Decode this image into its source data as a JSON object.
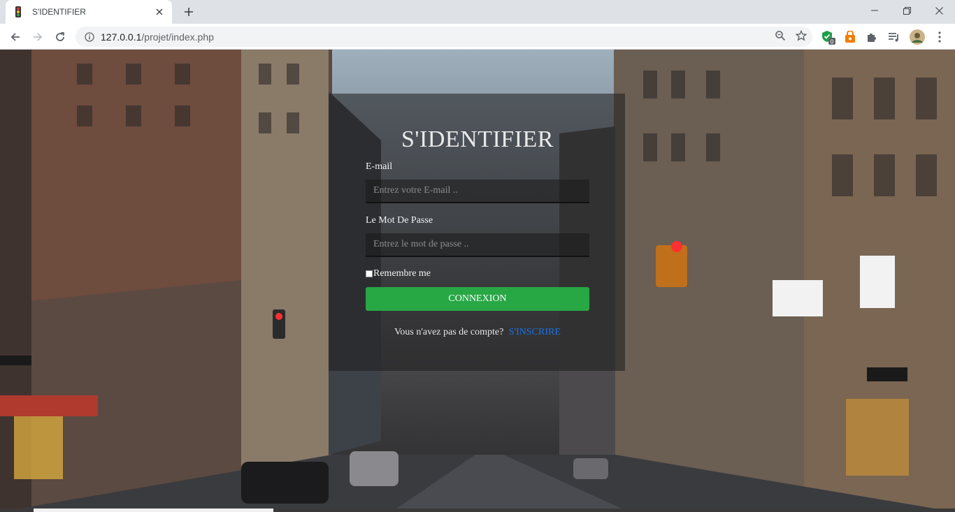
{
  "browser": {
    "tab_title": "S'IDENTIFIER",
    "url_host": "127.0.0.1",
    "url_path": "/projet/index.php",
    "ext_badge": "0"
  },
  "login": {
    "title": "S'IDENTIFIER",
    "email_label": "E-mail",
    "email_placeholder": "Entrez votre E-mail ..",
    "password_label": "Le Mot De Passe",
    "password_placeholder": "Entrez le mot de passe ..",
    "remember_label": "Remembre me",
    "submit_label": "CONNEXION",
    "signup_prompt": "Vous n'avez pas de compte?",
    "signup_link": "S'INSCRIRE"
  },
  "colors": {
    "submit_green": "#28a745",
    "link_blue": "#1a73e8"
  }
}
